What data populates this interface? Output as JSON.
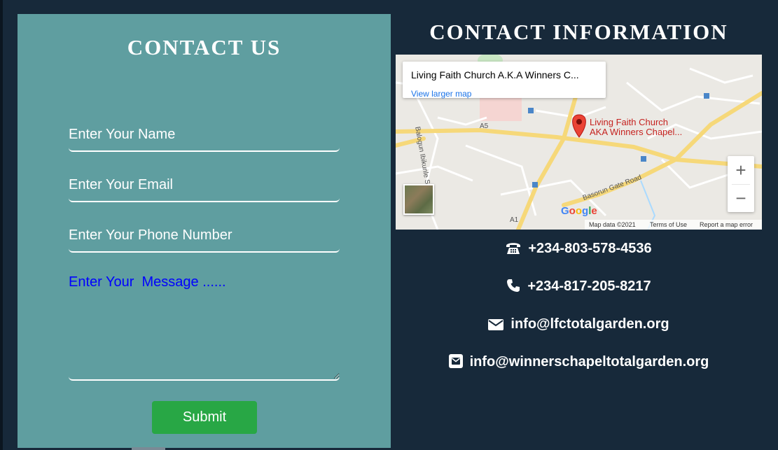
{
  "contact_form": {
    "title": "CONTACT US",
    "name_placeholder": "Enter Your Name",
    "email_placeholder": "Enter Your Email",
    "phone_placeholder": "Enter Your Phone Number",
    "message_placeholder": "Enter Your  Message ......",
    "submit_label": "Submit"
  },
  "contact_info": {
    "title": "CONTACT INFORMATION",
    "phone_1": "+234-803-578-4536",
    "phone_2": "+234-817-205-8217",
    "email_1": "info@lfctotalgarden.org",
    "email_2": "info@winnerschapeltotalgarden.org"
  },
  "map": {
    "place_title": "Living Faith Church A.K.A Winners C...",
    "view_larger": "View larger map",
    "pin_label_line1": "Living Faith Church",
    "pin_label_line2": "AKA Winners Chapel...",
    "road_a5": "A5",
    "road_a1": "A1",
    "road_basorun": "Basorun Gate Road",
    "road_balogun": "Balogun Ibikunle St",
    "zoom_in": "+",
    "zoom_out": "−",
    "google": "Google",
    "map_data": "Map data ©2021",
    "terms": "Terms of Use",
    "report": "Report a map error"
  },
  "colors": {
    "page_background": "#17293a",
    "form_background": "#5f9ea0",
    "submit_background": "#28a745",
    "message_text": "#0000ff",
    "pin": "#ea4335"
  },
  "icons": {
    "phone_1": "old-phone-icon",
    "phone_2": "phone-icon",
    "email_1": "envelope-icon",
    "email_2": "envelope-square-icon"
  }
}
